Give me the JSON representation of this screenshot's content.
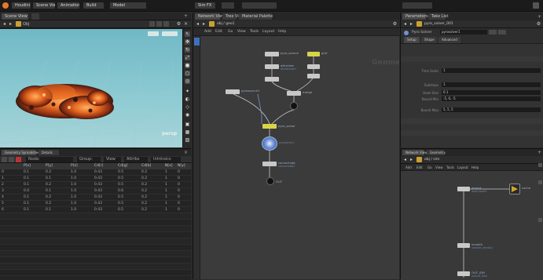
{
  "menubar": {
    "items": [
      "Houdini FX",
      "Scene View",
      "Animation",
      "Build",
      "Model",
      "Sim FX"
    ]
  },
  "viewport": {
    "tabs": [
      "Scene View",
      "Obj"
    ],
    "label": "persp"
  },
  "spreadsheet": {
    "tabs": [
      "Geometry Spreadsheet",
      "Details"
    ],
    "toolbar": [
      "Node:",
      "Group:",
      "View",
      "Attribs",
      "Intrinsics"
    ],
    "columns": [
      "",
      "P[x]",
      "P[y]",
      "P[z]",
      "Cd[r]",
      "Cd[g]",
      "Cd[b]",
      "N[x]",
      "N[y]",
      "N[z]"
    ],
    "rows": [
      [
        "0",
        "0.1",
        "0.2",
        "1.0",
        "0.43",
        "0.5",
        "0.2",
        "1",
        "0",
        "1"
      ],
      [
        "1",
        "0.1",
        "0.1",
        "1.0",
        "0.43",
        "0.5",
        "0.2",
        "1",
        "0",
        "1"
      ],
      [
        "2",
        "0.1",
        "0.2",
        "1.0",
        "0.43",
        "0.5",
        "0.2",
        "1",
        "0",
        "1"
      ],
      [
        "3",
        "0.0",
        "0.1",
        "1.0",
        "0.43",
        "0.6",
        "0.2",
        "1",
        "0",
        "1"
      ],
      [
        "4",
        "0.1",
        "0.2",
        "1.0",
        "0.43",
        "0.5",
        "0.2",
        "1",
        "0",
        "1"
      ],
      [
        "5",
        "0.1",
        "0.2",
        "1.0",
        "0.43",
        "0.5",
        "0.2",
        "1",
        "0",
        "1"
      ],
      [
        "6",
        "0.1",
        "0.1",
        "1.0",
        "0.43",
        "0.5",
        "0.2",
        "1",
        "0",
        "1"
      ]
    ]
  },
  "node_editor": {
    "tabs": [
      "Network View",
      "Tree View",
      "Material Palette"
    ],
    "toolbar": [
      "Add",
      "Edit",
      "Go",
      "View",
      "Tools",
      "Layout",
      "Help"
    ],
    "path": "obj / geo1",
    "watermark": "Geometry",
    "nodes": [
      {
        "id": "n1",
        "label": "pyro_source",
        "sub": "pyrosource1"
      },
      {
        "id": "n2",
        "label": "attrnoise",
        "sub": "attribnoise1"
      },
      {
        "id": "n3",
        "label": "rasterize",
        "sub": "volumerasterize1"
      },
      {
        "id": "n4",
        "label": "grid",
        "sub": "grid1"
      },
      {
        "id": "n5",
        "label": "merge",
        "sub": "merge1"
      },
      {
        "id": "n6",
        "label": "pyro_solver",
        "sub": "pyrosolver1"
      },
      {
        "id": "n7",
        "label": "convertvdb",
        "sub": "convertvdb1"
      },
      {
        "id": "n8",
        "label": "OUT",
        "sub": "output0"
      }
    ]
  },
  "parameter": {
    "tabs": [
      "Parameters",
      "Take List"
    ],
    "node_name": "pyrosolver1",
    "node_type": "Pyro Solver",
    "header_field": "pyro_solver_001",
    "sections": [
      "Setup",
      "Shape",
      "Advanced"
    ],
    "params": [
      {
        "label": "Time Scale",
        "value": "1"
      },
      {
        "label": "Substeps",
        "value": "1"
      },
      {
        "label": "Voxel Size",
        "value": "0.1"
      },
      {
        "label": "Bound Min",
        "value": "-5, 0, -5"
      },
      {
        "label": "Bound Max",
        "value": "5, 5, 5"
      }
    ]
  },
  "network2": {
    "tabs": [
      "Network View",
      "Geometry"
    ],
    "toolbar": [
      "Add",
      "Edit",
      "Go",
      "View",
      "Tools",
      "Layout",
      "Help"
    ],
    "path": "obj / sim",
    "nodes": [
      {
        "id": "m1",
        "label": "import",
        "sub": "dopimport1"
      },
      {
        "id": "m2",
        "label": "smooth",
        "sub": "smooth_density"
      },
      {
        "id": "m3",
        "label": "OUT_SIM",
        "sub": "output_final"
      },
      {
        "id": "m4",
        "label": "cache",
        "sub": "filecache1"
      }
    ]
  },
  "colors": {
    "accent_blue": "#3f6fc0",
    "node_yellow": "#d8d44a",
    "fire_orange": "#e76a22"
  }
}
